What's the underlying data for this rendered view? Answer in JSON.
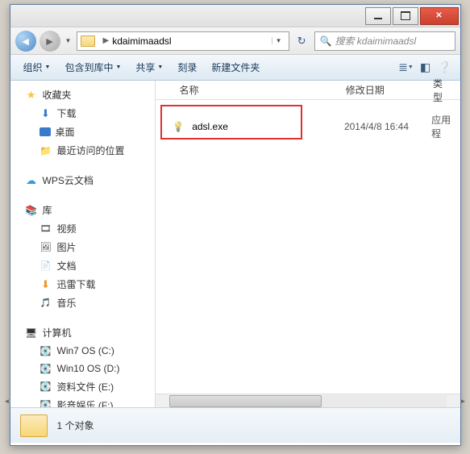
{
  "address": {
    "folder": "kdaimimaadsl"
  },
  "search": {
    "placeholder": "搜索 kdaimimaadsl"
  },
  "toolbar": {
    "organize": "组织",
    "include": "包含到库中",
    "share": "共享",
    "burn": "刻录",
    "newfolder": "新建文件夹"
  },
  "sidebar": {
    "favorites": "收藏夹",
    "downloads": "下载",
    "desktop": "桌面",
    "recent": "最近访问的位置",
    "wps": "WPS云文档",
    "libraries": "库",
    "videos": "视频",
    "pictures": "图片",
    "documents": "文档",
    "xunlei": "迅雷下载",
    "music": "音乐",
    "computer": "计算机",
    "drive_c": "Win7 OS (C:)",
    "drive_d": "Win10 OS (D:)",
    "drive_e": "资料文件 (E:)",
    "drive_f": "影音娱乐 (F:)"
  },
  "columns": {
    "name": "名称",
    "modified": "修改日期",
    "type": "类型"
  },
  "files": [
    {
      "name": "adsl.exe",
      "modified": "2014/4/8 16:44",
      "type": "应用程"
    }
  ],
  "status": {
    "count": "1 个对象"
  }
}
